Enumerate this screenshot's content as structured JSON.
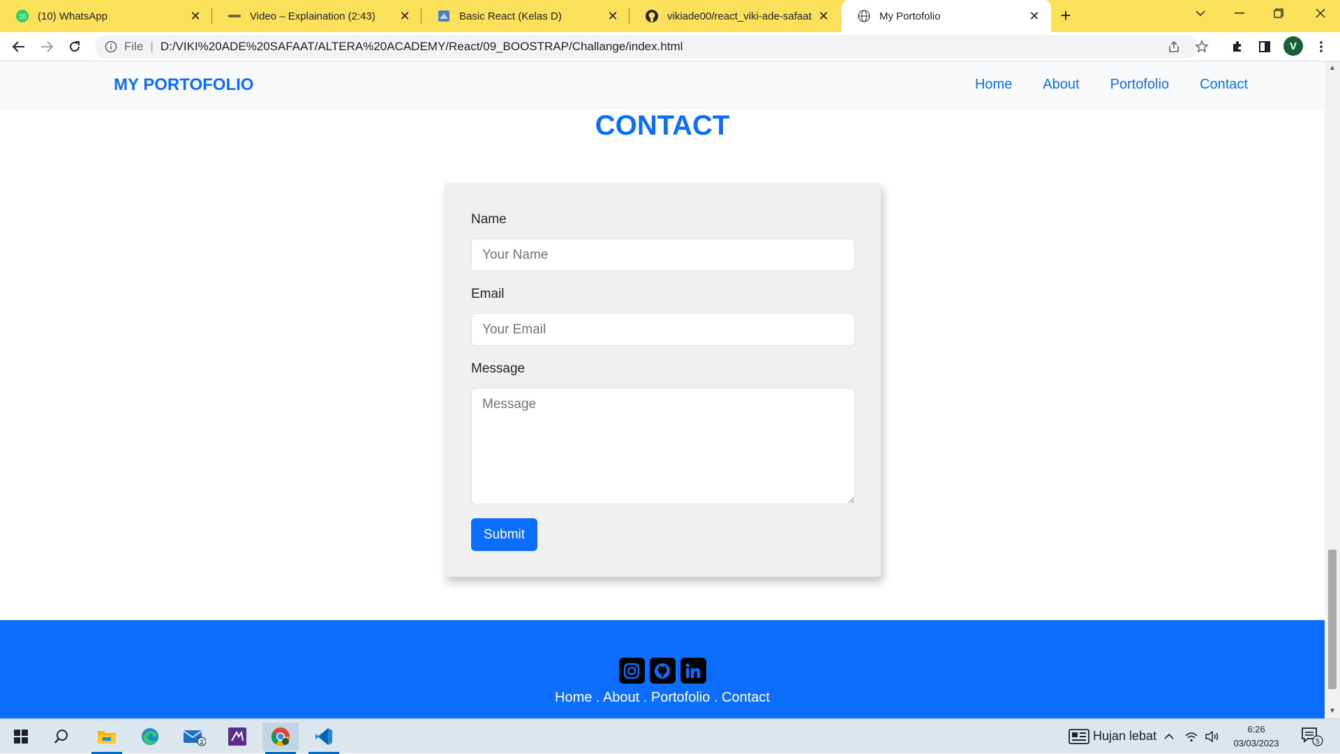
{
  "browser": {
    "tabs": [
      {
        "title": "(10) WhatsApp",
        "badge": "10",
        "active": false
      },
      {
        "title": "Video – Explaination (2:43)",
        "active": false
      },
      {
        "title": "Basic React (Kelas D)",
        "active": false
      },
      {
        "title": "vikiade00/react_viki-ade-safaat",
        "active": false
      },
      {
        "title": "My Portofolio",
        "active": true
      }
    ],
    "omnibox": {
      "scheme": "File",
      "url": "D:/VIKI%20ADE%20SAFAAT/ALTERA%20ACADEMY/React/09_BOOSTRAP/Challange/index.html"
    },
    "profile_initial": "V"
  },
  "site": {
    "brand": "MY PORTOFOLIO",
    "nav": [
      "Home",
      "About",
      "Portofolio",
      "Contact"
    ],
    "colors": {
      "primary": "#0d6efd"
    }
  },
  "contact": {
    "title": "CONTACT",
    "name_label": "Name",
    "name_placeholder": "Your Name",
    "email_label": "Email",
    "email_placeholder": "Your Email",
    "message_label": "Message",
    "message_placeholder": "Message",
    "submit_label": "Submit"
  },
  "footer": {
    "social_icons": [
      "instagram-icon",
      "github-icon",
      "linkedin-icon"
    ],
    "links": [
      "Home",
      "About",
      "Portofolio",
      "Contact"
    ],
    "separator": " . "
  },
  "taskbar": {
    "weather": "Hujan lebat",
    "time": "6:26",
    "date": "03/03/2023",
    "notifications": "5",
    "mail_badge": "2"
  }
}
